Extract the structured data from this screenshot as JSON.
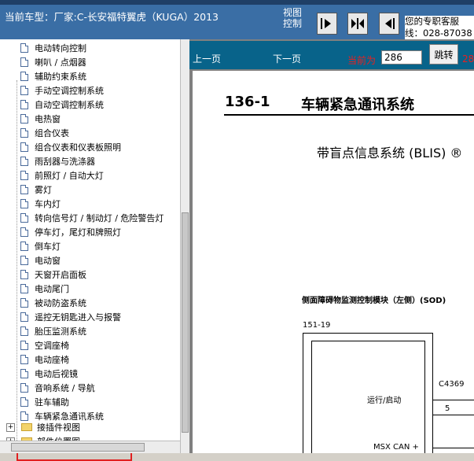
{
  "header": {
    "title": "当前车型：厂家:C-长安福特翼虎（KUGA）2013",
    "view_control_label": "视图控制",
    "support_line1": "您的专职客服",
    "support_line2": "线：028-87038"
  },
  "nav": {
    "prev": "上一页",
    "next": "下一页",
    "current_label": "当前为",
    "page_value": "286",
    "jump": "跳转",
    "total_partial": "28"
  },
  "tree": {
    "items": [
      "电动转向控制",
      "喇叭 / 点烟器",
      "辅助约束系统",
      "手动空调控制系统",
      "自动空调控制系统",
      "电热窗",
      "组合仪表",
      "组合仪表和仪表板照明",
      "雨刮器与洗涤器",
      "前照灯 / 自动大灯",
      "雾灯",
      "车内灯",
      "转向信号灯 / 制动灯 / 危险警告灯",
      "停车灯，尾灯和牌照灯",
      "倒车灯",
      "电动窗",
      "天窗开启面板",
      "电动尾门",
      "被动防盗系统",
      "遥控无钥匙进入与报警",
      "胎压监测系统",
      "空调座椅",
      "电动座椅",
      "电动后视镜",
      "音响系统 / 导航",
      "驻车辅助",
      "车辆紧急通讯系统"
    ],
    "selected": "车辆紧急通讯系统",
    "folders": [
      "接插件视图",
      "部件位置图"
    ]
  },
  "document": {
    "section_number": "136-1",
    "section_title": "车辆紧急通讯系统",
    "subtitle": "带盲点信息系统 (BLIS) ®",
    "module_label": "侧面障碍物监测控制模块（左侧）(SOD)",
    "connector_id": "151-19",
    "run_start_label": "运行/启动",
    "connector_c4369": "C4369",
    "pin_number": "5",
    "msx_can_label": "MSX CAN +"
  },
  "colors": {
    "header_bg": "#3a6ea5",
    "toolbar_bg": "#08638a",
    "highlight_border": "#e02020",
    "accent_red": "#e82020"
  }
}
